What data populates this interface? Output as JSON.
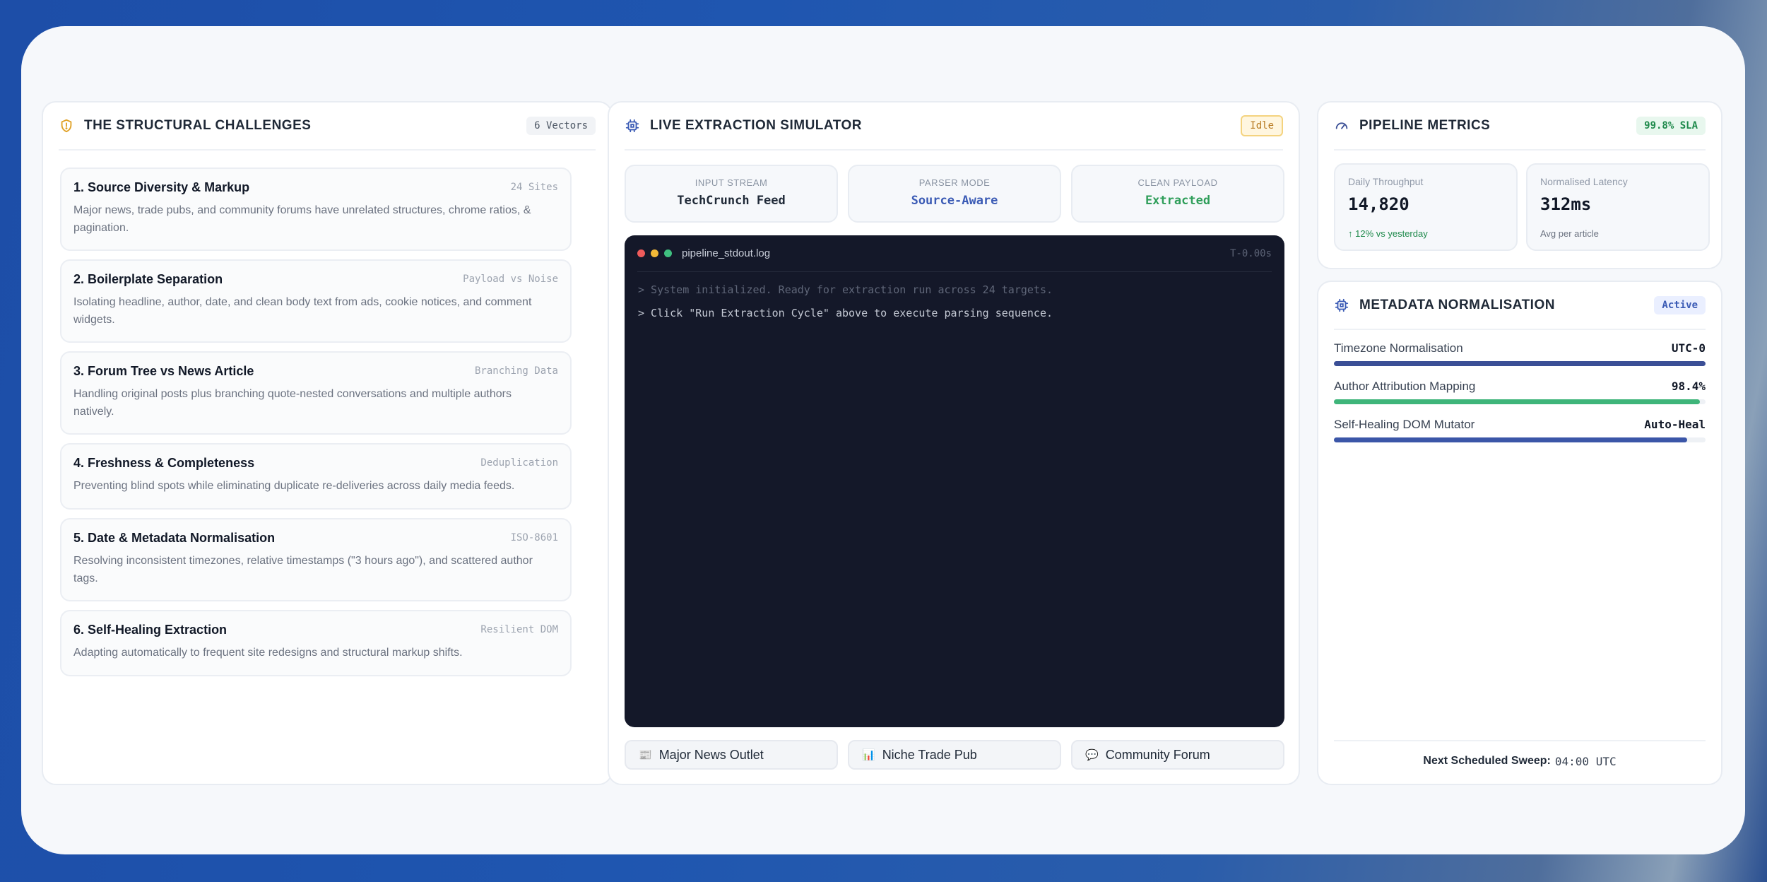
{
  "left": {
    "title": "THE STRUCTURAL CHALLENGES",
    "badge": "6 Vectors",
    "items": [
      {
        "title": "1. Source Diversity & Markup",
        "tag": "24 Sites",
        "desc": "Major news, trade pubs, and community forums have unrelated structures, chrome ratios, & pagination."
      },
      {
        "title": "2. Boilerplate Separation",
        "tag": "Payload vs Noise",
        "desc": "Isolating headline, author, date, and clean body text from ads, cookie notices, and comment widgets."
      },
      {
        "title": "3. Forum Tree vs News Article",
        "tag": "Branching Data",
        "desc": "Handling original posts plus branching quote-nested conversations and multiple authors natively."
      },
      {
        "title": "4. Freshness & Completeness",
        "tag": "Deduplication",
        "desc": "Preventing blind spots while eliminating duplicate re-deliveries across daily media feeds."
      },
      {
        "title": "5. Date & Metadata Normalisation",
        "tag": "ISO-8601",
        "desc": "Resolving inconsistent timezones, relative timestamps (\"3 hours ago\"), and scattered author tags."
      },
      {
        "title": "6. Self-Healing Extraction",
        "tag": "Resilient DOM",
        "desc": "Adapting automatically to frequent site redesigns and structural markup shifts."
      }
    ]
  },
  "middle": {
    "title": "LIVE EXTRACTION SIMULATOR",
    "badge": "Idle",
    "stats": [
      {
        "label": "INPUT STREAM",
        "value": "TechCrunch Feed",
        "color": "#1f2937"
      },
      {
        "label": "PARSER MODE",
        "value": "Source-Aware",
        "color": "#3b5bb5"
      },
      {
        "label": "CLEAN PAYLOAD",
        "value": "Extracted",
        "color": "#2f9e5a"
      }
    ],
    "terminal": {
      "file": "pipeline_stdout.log",
      "time": "T-0.00s",
      "lines": [
        "> System initialized. Ready for extraction run across 24 targets.",
        "> Click \"Run Extraction Cycle\" above to execute parsing sequence."
      ]
    },
    "sources": [
      {
        "icon": "📰",
        "label": "Major News Outlet"
      },
      {
        "icon": "📊",
        "label": "Niche Trade Pub"
      },
      {
        "icon": "💬",
        "label": "Community Forum"
      }
    ]
  },
  "metrics": {
    "title": "PIPELINE METRICS",
    "badge": "99.8% SLA",
    "cards": [
      {
        "label": "Daily Throughput",
        "value": "14,820",
        "sub": "↑ 12% vs yesterday"
      },
      {
        "label": "Normalised Latency",
        "value": "312ms",
        "sub": "Avg per article"
      }
    ]
  },
  "normalisation": {
    "title": "METADATA NORMALISATION",
    "badge": "Active",
    "rows": [
      {
        "label": "Timezone Normalisation",
        "value": "UTC-0",
        "level": 1.0,
        "color": "#3b4f96"
      },
      {
        "label": "Author Attribution Mapping",
        "value": "98.4%",
        "level": 0.984,
        "color": "#3fb57a"
      },
      {
        "label": "Self-Healing DOM Mutator",
        "value": "Auto-Heal",
        "level": 0.95,
        "color": "#3b56a8"
      }
    ],
    "sweep_label": "Next Scheduled Sweep:",
    "sweep_time": "04:00 UTC"
  }
}
